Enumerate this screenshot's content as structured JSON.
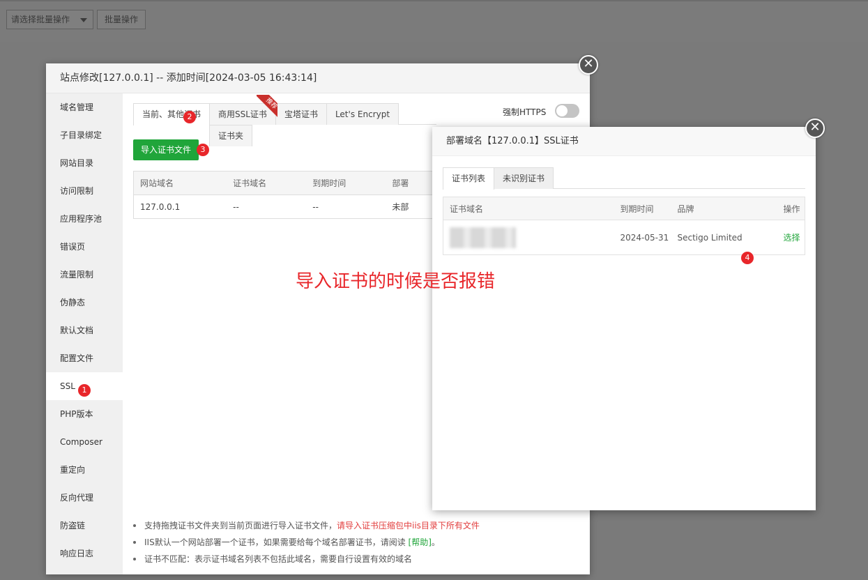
{
  "toolbar": {
    "batch_select_placeholder": "请选择批量操作",
    "batch_button": "批量操作"
  },
  "main_modal": {
    "title": "站点修改[127.0.0.1] -- 添加时间[2024-03-05 16:43:14]",
    "close_icon": "close-icon",
    "sidebar": [
      {
        "label": "域名管理"
      },
      {
        "label": "子目录绑定"
      },
      {
        "label": "网站目录"
      },
      {
        "label": "访问限制"
      },
      {
        "label": "应用程序池"
      },
      {
        "label": "错误页"
      },
      {
        "label": "流量限制"
      },
      {
        "label": "伪静态"
      },
      {
        "label": "默认文档"
      },
      {
        "label": "配置文件"
      },
      {
        "label": "SSL"
      },
      {
        "label": "PHP版本"
      },
      {
        "label": "Composer"
      },
      {
        "label": "重定向"
      },
      {
        "label": "反向代理"
      },
      {
        "label": "防盗链"
      },
      {
        "label": "响应日志"
      }
    ],
    "tabs": [
      {
        "label": "当前、其他证书"
      },
      {
        "label": "商用SSL证书"
      },
      {
        "label": "宝塔证书"
      },
      {
        "label": "Let's Encrypt"
      },
      {
        "label": "证书夹"
      }
    ],
    "ribbon_text": "推荐",
    "force_https_label": "强制HTTPS",
    "force_https_on": false,
    "import_button": "导入证书文件",
    "site_table": {
      "headers": [
        "网站域名",
        "证书域名",
        "到期时间",
        "部署"
      ],
      "rows": [
        [
          "127.0.0.1",
          "--",
          "--",
          "未部"
        ]
      ]
    },
    "notes": {
      "n1_text": "支持拖拽证书文件夹到当前页面进行导入证书文件，",
      "n1_red": "请导入证书压缩包中iis目录下所有文件",
      "n2_text": "IIS默认一个网站部署一个证书，如果需要给每个域名部署证书，请阅读 ",
      "n2_link": "[帮助]",
      "n2_end": "。",
      "n3_text": "证书不匹配：表示证书域名列表不包括此域名，需要自行设置有效的域名"
    }
  },
  "ssl_modal": {
    "title": "部署域名【127.0.0.1】SSL证书",
    "close_icon": "close-icon",
    "tabs": [
      {
        "label": "证书列表"
      },
      {
        "label": "未识别证书"
      }
    ],
    "table": {
      "headers": [
        "证书域名",
        "到期时间",
        "品牌",
        "操作"
      ],
      "rows": [
        {
          "expiry": "2024-05-31",
          "brand": "Sectigo Limited",
          "action": "选择"
        }
      ]
    }
  },
  "badges": {
    "b1": "1",
    "b2": "2",
    "b3": "3",
    "b4": "4"
  },
  "annotation": "导入证书的时候是否报错",
  "colors": {
    "accent_green": "#20a53a",
    "badge_red": "#e8262a",
    "ribbon_red": "#c9302c"
  }
}
